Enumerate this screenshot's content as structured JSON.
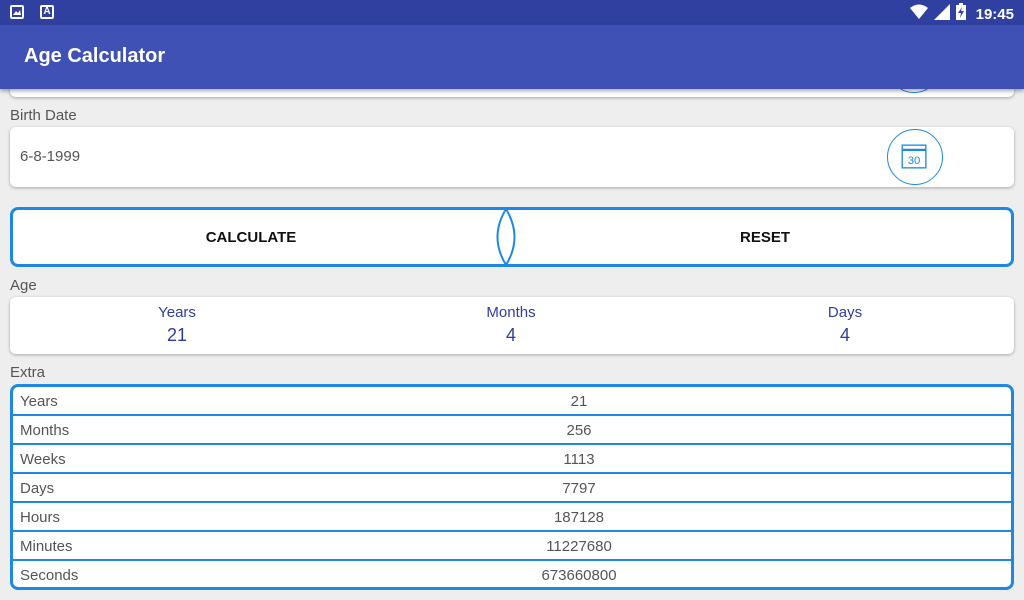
{
  "status_bar": {
    "time": "19:45",
    "left_icons": [
      "image-icon",
      "a-icon"
    ],
    "right_icons": [
      "wifi-icon",
      "signal-icon",
      "battery-charging-icon"
    ]
  },
  "app_bar": {
    "title": "Age Calculator"
  },
  "birth_date": {
    "label": "Birth Date",
    "value": "6-8-1999",
    "calendar_number": "30"
  },
  "actions": {
    "calculate": "CALCULATE",
    "reset": "RESET"
  },
  "age": {
    "label": "Age",
    "columns": [
      {
        "header": "Years",
        "value": "21"
      },
      {
        "header": "Months",
        "value": "4"
      },
      {
        "header": "Days",
        "value": "4"
      }
    ]
  },
  "extra": {
    "label": "Extra",
    "rows": [
      {
        "key": "Years",
        "value": "21"
      },
      {
        "key": "Months",
        "value": "256"
      },
      {
        "key": "Weeks",
        "value": "1113"
      },
      {
        "key": "Days",
        "value": "7797"
      },
      {
        "key": "Hours",
        "value": "187128"
      },
      {
        "key": "Minutes",
        "value": "11227680"
      },
      {
        "key": "Seconds",
        "value": "673660800"
      }
    ]
  },
  "colors": {
    "status_bar": "#3040a0",
    "app_bar": "#3f51b5",
    "accent_border": "#1e88e5",
    "age_text": "#2f3e9e"
  }
}
